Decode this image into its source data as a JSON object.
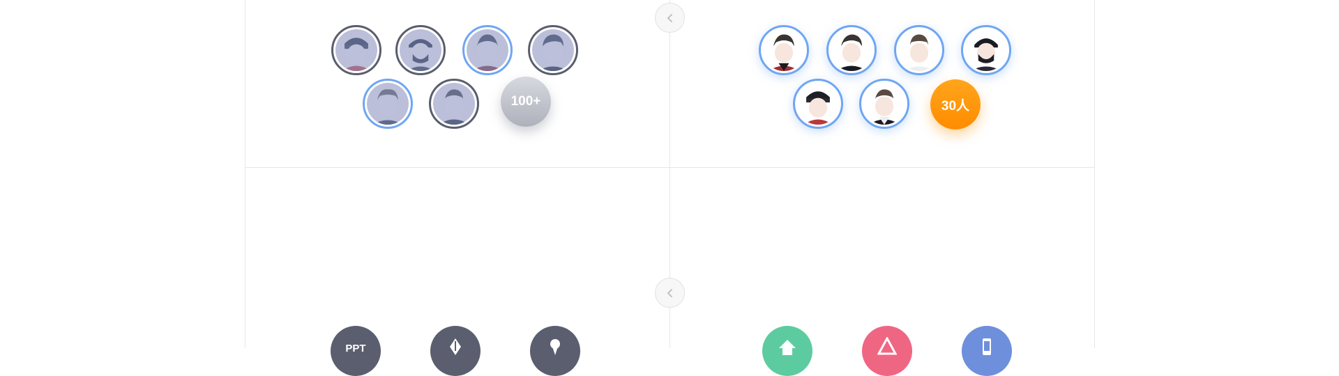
{
  "panels": {
    "left_members": {
      "count_label": "100+",
      "count_color": "#aeb1bb"
    },
    "right_members": {
      "count_label": "30人",
      "count_color": "#ff9a0f"
    },
    "left_tools": {
      "items": [
        {
          "label": "PPT",
          "icon": "ppt-icon",
          "color": "#5a5e6f"
        },
        {
          "label": "",
          "icon": "pen-nib-icon",
          "color": "#5a5e6f"
        },
        {
          "label": "",
          "icon": "map-pin-icon",
          "color": "#5a5e6f"
        }
      ]
    },
    "right_tools": {
      "items": [
        {
          "label": "",
          "icon": "home-icon",
          "color": "#5ccca0"
        },
        {
          "label": "",
          "icon": "triangle-icon",
          "color": "#ef6683"
        },
        {
          "label": "",
          "icon": "phone-icon",
          "color": "#6e8fdc"
        }
      ]
    }
  },
  "colors": {
    "accent_blue": "#6fa6f2",
    "dark_ring": "#5a5e6b",
    "divider": "#e7e7e7"
  }
}
